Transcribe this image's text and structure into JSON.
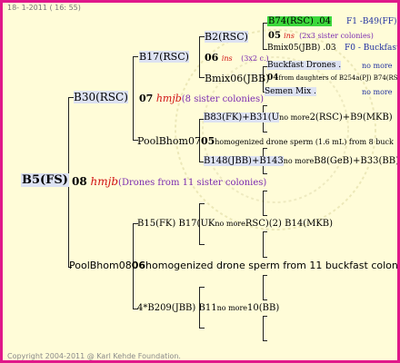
{
  "header": {
    "date": "18- 1-2011 ( 16: 55)"
  },
  "footer": {
    "copyright": "Copyright 2004-2011 @ Karl Kehde Foundation."
  },
  "colors": {
    "frame": "#e0188a",
    "background": "#fffcd8",
    "highlight_green": "#3cd83c",
    "name_box": "#dde2f2"
  },
  "root": {
    "id": "B5(FS)",
    "gen": "08",
    "origin": "hmjb",
    "note": "(Drones from 11 sister colonies)"
  },
  "sire": {
    "id": "B30(RSC)",
    "gen": "07",
    "origin": "hmjb",
    "note": "(8 sister colonies)"
  },
  "dam": {
    "id": "PoolBhom08",
    "gen": "06",
    "note": "homogenized drone sperm from 11 buckfast colonies"
  },
  "sire_sire": {
    "id": "B17(RSC)",
    "gen": "06",
    "origin": "ins",
    "note": "(3x2 c.)"
  },
  "sire_dam": {
    "id": "PoolBhom07",
    "gen": "05",
    "note": "homogenized drone sperm (1.6 mL) from 8 buck"
  },
  "sss": {
    "id": "B2(RSC)"
  },
  "ssd": {
    "id": "Bmix06(JBB)"
  },
  "ssss": {
    "id": "B74(RSC) .04",
    "right": "F1 -B49(FF)",
    "gen": "05",
    "origin": "ins",
    "note": "(2x3 sister colonies)"
  },
  "sssd": {
    "id": "Bmix05(JBB) .03",
    "right": "F0 - Buckfast"
  },
  "ssds": {
    "id": "Buckfast Drones .",
    "right": "no more",
    "gen": "04",
    "note": "from daughters of B254a(PJ) B74(RS"
  },
  "ssdd": {
    "id": "Semen Mix .",
    "right": "no more"
  },
  "sds": {
    "a": "B83(FK)+B31(U",
    "b": "no more",
    "c": "2(RSC)+B9(MKB)"
  },
  "sdd": {
    "a": "B148(JBB)+B143",
    "b": "no more",
    "c": "B8(GeB)+B33(BB)"
  },
  "ds": {
    "a": "B15(FK) B17(UK",
    "b": "no more",
    "c": "RSC)(2) B14(MKB)"
  },
  "dd": {
    "a": "4*B209(JBB) B11",
    "b": "no more",
    "c": "10(BB)"
  }
}
